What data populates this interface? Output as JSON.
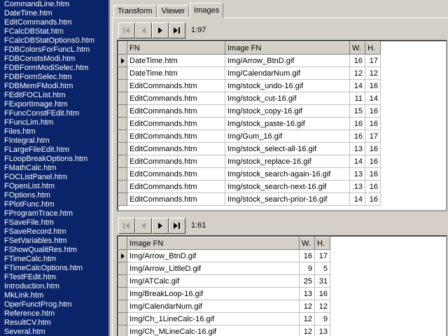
{
  "file_list": [
    "CommandLine.htm",
    "DateTime.htm",
    "EditCommands.htm",
    "FCalcDBStat.htm",
    "FCalcDBStatOptions0.htm",
    "FDBColorsForFuncL.htm",
    "FDBConstsModi.htm",
    "FDBFormModiSelec.htm",
    "FDBFormSelec.htm",
    "FDBMemFModi.htm",
    "FEditFOCList.htm",
    "FExportImage.htm",
    "FFuncConstFEdit.htm",
    "FFuncLim.htm",
    "Files.htm",
    "FIntegral.htm",
    "FLargeFileEdit.htm",
    "FLoopBreakOptions.htm",
    "FMathCalc.htm",
    "FOCListPanel.htm",
    "FOpenList.htm",
    "FOptions.htm",
    "FPlotFunc.htm",
    "FProgramTrace.htm",
    "FSaveFile.htm",
    "FSaveRecord.htm",
    "FSetVariables.htm",
    "FShowQualitRes.htm",
    "FTimeCalc.htm",
    "FTimeCalcOptions.htm",
    "FTestFEdit.htm",
    "Introduction.htm",
    "MkLink.htm",
    "OperFunctProg.htm",
    "Reference.htm",
    "ResultCV.htm",
    "Several.htm"
  ],
  "tabs": [
    {
      "label": "Transform"
    },
    {
      "label": "Viewer"
    },
    {
      "label": "Images"
    }
  ],
  "nav_top": {
    "position": "1:97"
  },
  "nav_bottom": {
    "position": "1:61"
  },
  "grid_top": {
    "headers": [
      "FN",
      "Image FN",
      "W.",
      "H."
    ],
    "rows": [
      [
        "DateTime.htm",
        "Img/Arrow_BtnD.gif",
        "16",
        "17"
      ],
      [
        "DateTime.htm",
        "Img/CalendarNum.gif",
        "12",
        "12"
      ],
      [
        "EditCommands.htm",
        "Img/stock_undo-16.gif",
        "14",
        "16"
      ],
      [
        "EditCommands.htm",
        "Img/stock_cut-16.gif",
        "11",
        "14"
      ],
      [
        "EditCommands.htm",
        "Img/stock_copy-16.gif",
        "15",
        "16"
      ],
      [
        "EditCommands.htm",
        "Img/stock_paste-16.gif",
        "16",
        "16"
      ],
      [
        "EditCommands.htm",
        "Img/Gum_16.gif",
        "16",
        "17"
      ],
      [
        "EditCommands.htm",
        "Img/stock_select-all-16.gif",
        "13",
        "16"
      ],
      [
        "EditCommands.htm",
        "Img/stock_replace-16.gif",
        "14",
        "16"
      ],
      [
        "EditCommands.htm",
        "Img/stock_search-again-16.gif",
        "13",
        "16"
      ],
      [
        "EditCommands.htm",
        "Img/stock_search-next-16.gif",
        "13",
        "16"
      ],
      [
        "EditCommands.htm",
        "Img/stock_search-prior-16.gif",
        "14",
        "16"
      ]
    ]
  },
  "grid_bottom": {
    "headers": [
      "Image FN",
      "W.",
      "H."
    ],
    "rows": [
      [
        "Img/Arrow_BtnD.gif",
        "16",
        "17"
      ],
      [
        "Img/Arrow_LittleD.gif",
        "9",
        "5"
      ],
      [
        "Img/ATCalc.gif",
        "25",
        "31"
      ],
      [
        "Img/BreakLoop-16.gif",
        "13",
        "16"
      ],
      [
        "Img/CalendarNum.gif",
        "12",
        "12"
      ],
      [
        "Img/Ch_1LineCalc-16.gif",
        "12",
        "9"
      ],
      [
        "Img/Ch_MLineCalc-16.gif",
        "12",
        "13"
      ]
    ]
  },
  "icons": {
    "first": "⏮",
    "prior": "◀",
    "next": "▶",
    "last": "⏭"
  },
  "colors": {
    "list_bg": "#0a246a",
    "face": "#d4d0c8"
  }
}
